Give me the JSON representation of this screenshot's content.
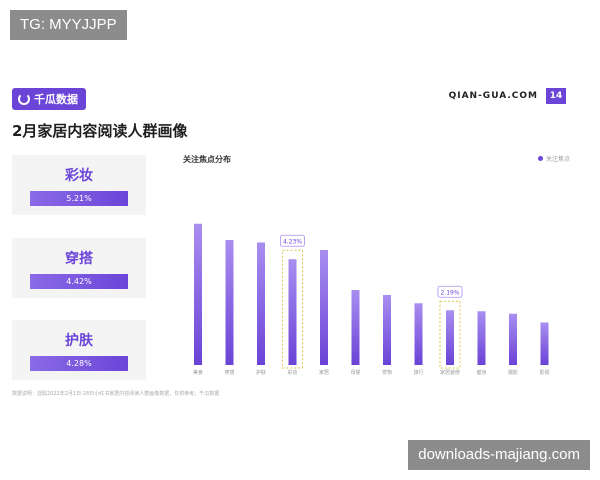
{
  "watermark_top": "TG: MYYJJPP",
  "watermark_bottom": "downloads-majiang.com",
  "header": {
    "brand": "千瓜数据",
    "site": "QIAN-GUA.COM",
    "page_number": "14"
  },
  "page_title": "2月家居内容阅读人群画像",
  "left_cards": [
    {
      "name": "彩妆",
      "pct": "5.21%"
    },
    {
      "name": "穿搭",
      "pct": "4.42%"
    },
    {
      "name": "护肤",
      "pct": "4.28%"
    }
  ],
  "chart_title": "关注焦点分布",
  "legend_label": "关注焦点",
  "footnote": "数据说明：选取2022年2月1日-28日小红书家居内容阅读人群画像数据，仅供参考；千瓜数据",
  "colors": {
    "accent": "#6b45d8",
    "bar_top": "#a98ef0",
    "bar_bottom": "#6a43d6",
    "highlight": "#e3c24a"
  },
  "chart_data": {
    "type": "bar",
    "categories": [
      "美食",
      "穿搭",
      "护肤",
      "彩妆",
      "家居",
      "母婴",
      "宠物",
      "旅行",
      "家居装修",
      "健身",
      "摄影",
      "影视"
    ],
    "values": [
      5.65,
      5.0,
      4.9,
      4.23,
      4.6,
      3.0,
      2.8,
      2.47,
      2.19,
      2.15,
      2.05,
      1.7
    ],
    "annotations": [
      {
        "category": "彩妆",
        "label": "4.23%"
      },
      {
        "category": "家居装修",
        "label": "2.19%"
      }
    ],
    "ylim": [
      0,
      6
    ],
    "grid": false,
    "legend": "top-right"
  }
}
